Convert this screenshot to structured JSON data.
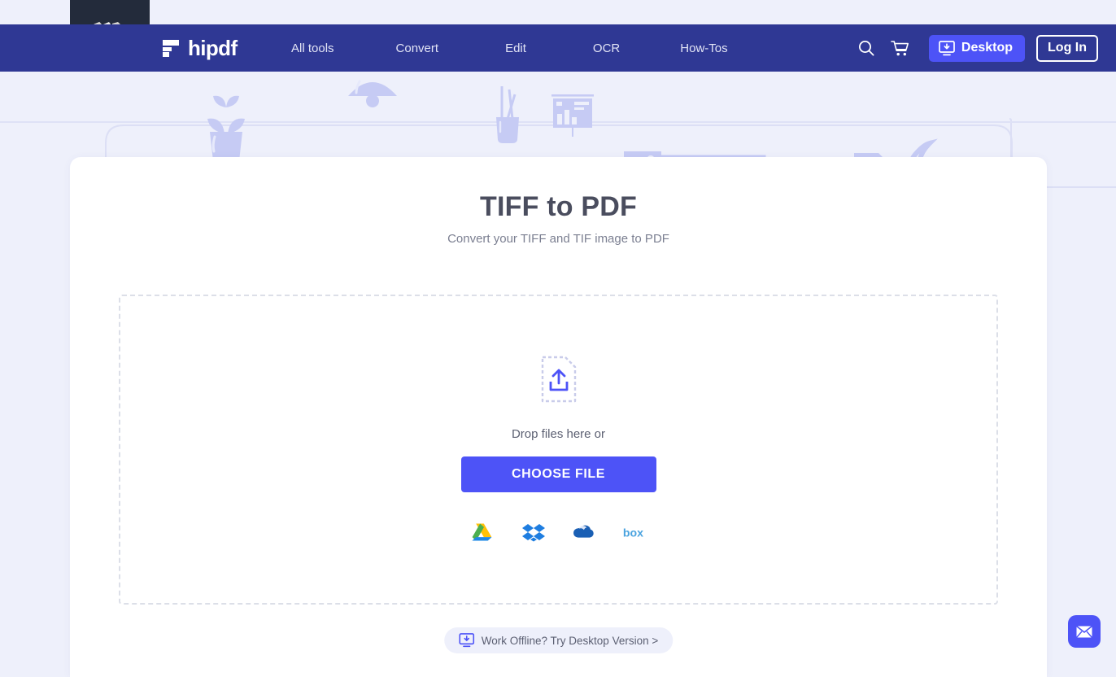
{
  "brand": {
    "parent_name": "wondershare",
    "product_name": "hipdf",
    "logo_icon": "hipdf-logo-icon",
    "parent_logo_icon": "wondershare-logo-icon",
    "nav_bg": "#2f3894",
    "accent": "#4d53f7",
    "page_bg": "#eef0fb",
    "dark_block": "#232b3b"
  },
  "nav": {
    "links": [
      {
        "label": "All tools"
      },
      {
        "label": "Convert"
      },
      {
        "label": "Edit"
      },
      {
        "label": "OCR"
      },
      {
        "label": "How-Tos"
      }
    ],
    "search_icon": "search-icon",
    "cart_icon": "shopping-cart-icon",
    "desktop_button": {
      "label": "Desktop",
      "icon": "desktop-download-icon"
    },
    "login_button": {
      "label": "Log In"
    }
  },
  "hero": {
    "illustration_items": [
      "potted-plant-icon",
      "hanging-lamp-icon",
      "pencil-cup-icon",
      "bar-chart-board-icon",
      "dashboard-screen-icon",
      "photo-thumbnail-icon",
      "document-page-icon",
      "steaming-cup-icon"
    ]
  },
  "main": {
    "title": "TIFF to PDF",
    "subtitle": "Convert your TIFF and TIF image to PDF",
    "dropzone": {
      "upload_icon": "file-upload-icon",
      "drop_text": "Drop files here or",
      "choose_file_label": "CHOOSE FILE",
      "cloud_sources": [
        {
          "name": "google-drive-icon",
          "label": "Google Drive"
        },
        {
          "name": "dropbox-icon",
          "label": "Dropbox"
        },
        {
          "name": "onedrive-icon",
          "label": "OneDrive"
        },
        {
          "name": "box-icon",
          "label": "Box"
        }
      ]
    },
    "offline_pill": {
      "label": "Work Offline? Try Desktop Version >",
      "icon": "desktop-download-icon"
    }
  },
  "widgets": {
    "mail_fab_icon": "envelope-icon"
  }
}
